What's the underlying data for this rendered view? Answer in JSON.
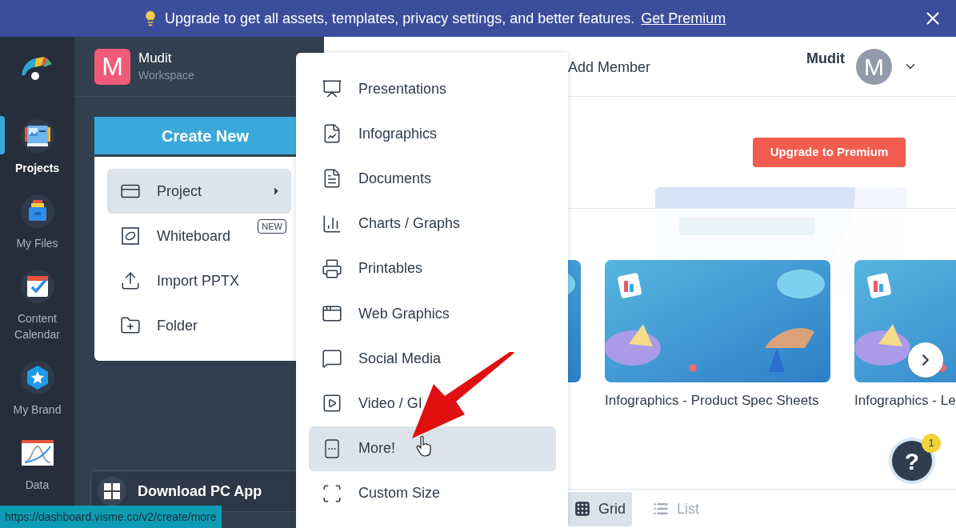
{
  "banner": {
    "text": "Upgrade to get all assets, templates, privacy settings, and better features.",
    "link": "Get Premium"
  },
  "rail": [
    {
      "label": "Projects",
      "selected": true,
      "kind": "projects"
    },
    {
      "label": "My Files",
      "selected": false,
      "kind": "files"
    },
    {
      "label": "Content Calendar",
      "selected": false,
      "kind": "calendar"
    },
    {
      "label": "My Brand",
      "selected": false,
      "kind": "brand"
    },
    {
      "label": "Data",
      "selected": false,
      "kind": "data"
    }
  ],
  "workspace": {
    "avatar_letter": "M",
    "name": "Mudit",
    "subtitle": "Workspace"
  },
  "create_button": "Create New",
  "create_menu": [
    {
      "label": "Project",
      "selected": true,
      "has_submenu": true,
      "kind": "project"
    },
    {
      "label": "Whiteboard",
      "selected": false,
      "has_submenu": false,
      "kind": "whiteboard",
      "badge": "NEW"
    },
    {
      "label": "Import PPTX",
      "selected": false,
      "has_submenu": false,
      "kind": "import"
    },
    {
      "label": "Folder",
      "selected": false,
      "has_submenu": false,
      "kind": "folder"
    }
  ],
  "download_button": "Download PC App",
  "submenu": [
    {
      "label": "Presentations",
      "selected": false,
      "kind": "presentation"
    },
    {
      "label": "Infographics",
      "selected": false,
      "kind": "infographic"
    },
    {
      "label": "Documents",
      "selected": false,
      "kind": "document"
    },
    {
      "label": "Charts / Graphs",
      "selected": false,
      "kind": "chart"
    },
    {
      "label": "Printables",
      "selected": false,
      "kind": "printable"
    },
    {
      "label": "Web Graphics",
      "selected": false,
      "kind": "web"
    },
    {
      "label": "Social Media",
      "selected": false,
      "kind": "social"
    },
    {
      "label": "Video / GI",
      "selected": false,
      "kind": "video"
    },
    {
      "label": "More!",
      "selected": true,
      "kind": "more"
    },
    {
      "label": "Custom Size",
      "selected": false,
      "kind": "custom_size"
    }
  ],
  "header": {
    "add_member": "Add Member",
    "user_name": "Mudit",
    "avatar_letter": "M"
  },
  "upgrade_button": "Upgrade to Premium",
  "templates": [
    {
      "kind": "picture"
    },
    {
      "kind": "picture",
      "caption": "Infographics - Product Spec Sheets"
    },
    {
      "kind": "picture",
      "caption": "Infographics - Le"
    }
  ],
  "view_toggle": [
    {
      "label": "Grid",
      "selected": true,
      "kind": "grid"
    },
    {
      "label": "List",
      "selected": false,
      "kind": "list"
    }
  ],
  "help": {
    "label": "?",
    "badge": "1"
  },
  "status_url": "https://dashboard.visme.co/v2/create/more"
}
